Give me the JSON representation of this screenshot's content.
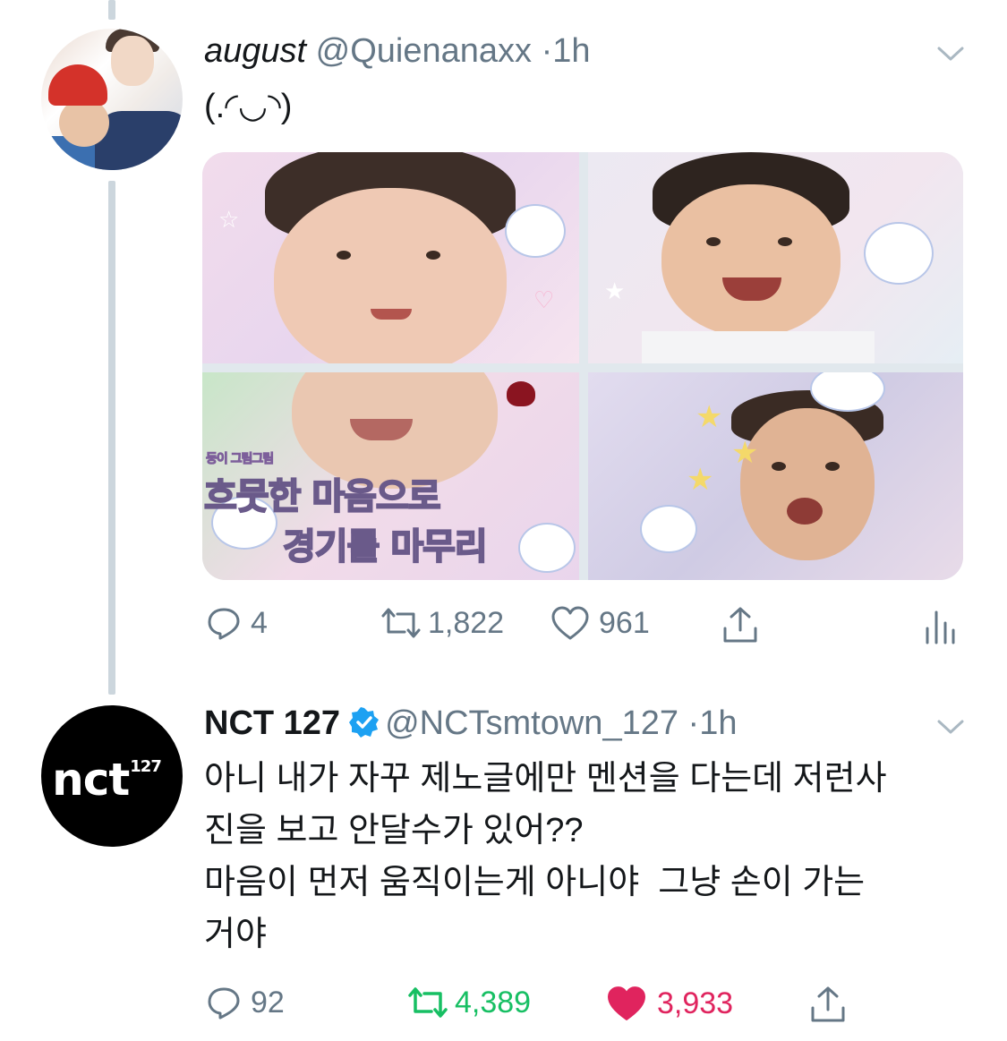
{
  "tweets": [
    {
      "display_name": "august",
      "handle": "@Quienanaxx",
      "separator": "·",
      "time": "1h",
      "text": "(.◜◡◝)",
      "avatar_icon": "profile-photo-icon",
      "media_count": 4,
      "media_overlay_text": [
        "둥이 그림그림",
        "흐뭇한 마음으로",
        "경기를 마무리"
      ],
      "actions": {
        "replies": "4",
        "retweets": "1,822",
        "likes": "961",
        "analytics_icon": "bar-chart-icon"
      }
    },
    {
      "display_name": "NCT 127",
      "handle": "@NCTsmtown_127",
      "separator": "·",
      "time": "1h",
      "verified": true,
      "avatar_logo": {
        "main": "nct",
        "sup": "127"
      },
      "text_lines": [
        "아니 내가 자꾸 제노글에만 멘션을 다는데 저런사",
        "진을 보고 안달수가 있어??",
        "마음이 먼저 움직이는게 아니야  그냥 손이 가는",
        "거야"
      ],
      "actions": {
        "replies": "92",
        "retweets": "4,389",
        "likes": "3,933",
        "retweeted": true,
        "liked": true
      }
    }
  ],
  "colors": {
    "text": "#14171a",
    "muted": "#657786",
    "thread_line": "#ccd6dd",
    "verified_blue": "#1da1f2",
    "retweet_green": "#17bf63",
    "like_red": "#e0245e"
  }
}
